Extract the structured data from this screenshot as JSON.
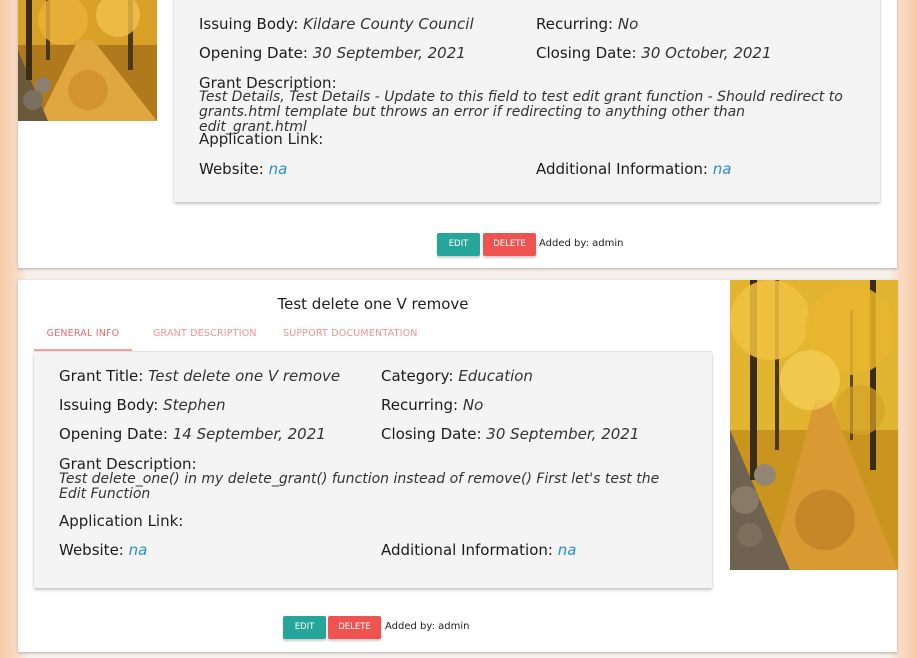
{
  "colors": {
    "accent_teal": "#26a69a",
    "delete_red": "#ef5350",
    "link_blue": "#2a8fd0",
    "tab_pink": "#f19292"
  },
  "cards": [
    {
      "fields": {
        "issuing_body_label": "Issuing Body:",
        "issuing_body": "Kildare County Council",
        "recurring_label": "Recurring:",
        "recurring": "No",
        "opening_label": "Opening Date:",
        "opening": "30 September, 2021",
        "closing_label": "Closing Date:",
        "closing": "30 October, 2021",
        "description_label": "Grant Description:",
        "description": "Test Details, Test Details - Update to this field to test edit grant function - Should redirect to grants.html template but throws an error if redirecting to anything other than edit_grant.html",
        "application_link_label": "Application Link:",
        "website_label": "Website:",
        "website": "na",
        "additional_label": "Additional Information:",
        "additional": "na"
      },
      "edit_label": "Edit",
      "delete_label": "Delete",
      "added_by": "Added by: admin"
    },
    {
      "title": "Test delete one V remove",
      "tabs": [
        "General Info",
        "Grant Description",
        "Support Documentation"
      ],
      "fields": {
        "grant_title_label": "Grant Title:",
        "grant_title": "Test delete one V remove",
        "category_label": "Category:",
        "category": "Education",
        "issuing_body_label": "Issuing Body:",
        "issuing_body": "Stephen",
        "recurring_label": "Recurring:",
        "recurring": "No",
        "opening_label": "Opening Date:",
        "opening": "14 September, 2021",
        "closing_label": "Closing Date:",
        "closing": "30 September, 2021",
        "description_label": "Grant Description:",
        "description": "Test delete_one() in my delete_grant() function instead of remove() First let's test the Edit Function",
        "application_link_label": "Application Link:",
        "website_label": "Website:",
        "website": "na",
        "additional_label": "Additional Information:",
        "additional": "na"
      },
      "edit_label": "Edit",
      "delete_label": "Delete",
      "added_by": "Added by: admin"
    }
  ]
}
